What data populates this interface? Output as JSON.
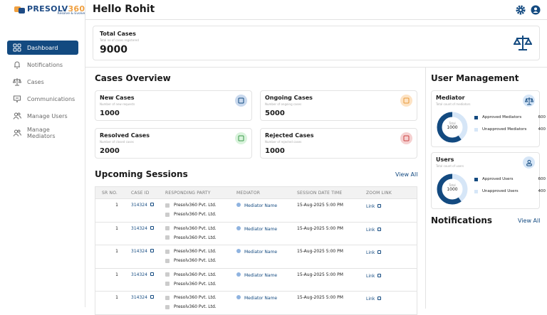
{
  "brand": {
    "name": "PRESOLV",
    "num": "360",
    "tagline": "Resolve & Evolve"
  },
  "sidebar": {
    "items": [
      {
        "label": "Dashboard",
        "icon": "grid-icon",
        "active": true
      },
      {
        "label": "Notifications",
        "icon": "bell-icon"
      },
      {
        "label": "Cases",
        "icon": "scales-icon"
      },
      {
        "label": "Communications",
        "icon": "chat-icon"
      },
      {
        "label": "Manage Users",
        "icon": "users-icon"
      },
      {
        "label": "Manage Mediators",
        "icon": "users-icon"
      }
    ]
  },
  "header": {
    "greeting": "Hello Rohit"
  },
  "total": {
    "title": "Total Cases",
    "sub": "Total no of cases registered",
    "value": "9000"
  },
  "overview": {
    "title": "Cases Overview",
    "cards": [
      {
        "title": "New Cases",
        "sub": "Number of new requests",
        "value": "1000",
        "color": "#c9d9ee"
      },
      {
        "title": "Ongoing Cases",
        "sub": "Number of ongoing cases",
        "value": "5000",
        "color": "#fde3c4"
      },
      {
        "title": "Resolved Cases",
        "sub": "Number of closed cases",
        "value": "2000",
        "color": "#d9f3dc"
      },
      {
        "title": "Rejected Cases",
        "sub": "Number of rejected cases",
        "value": "1000",
        "color": "#f5d0d0"
      }
    ]
  },
  "sessions": {
    "title": "Upcoming Sessions",
    "view_all": "View All",
    "columns": [
      "SR NO.",
      "CASE ID",
      "RESPONDING PARTY",
      "MEDIATOR",
      "SESSION DATE TIME",
      "ZOOM LINK"
    ],
    "rows": [
      {
        "sr": "1",
        "case": "314324",
        "party1": "Presolv360 Pvt. Ltd.",
        "party2": "Presolv360 Pvt. Ltd.",
        "mediator": "Mediator Name",
        "date": "15-Aug-2025 5:00 PM",
        "link": "Link"
      },
      {
        "sr": "1",
        "case": "314324",
        "party1": "Presolv360 Pvt. Ltd.",
        "party2": "Presolv360 Pvt. Ltd.",
        "mediator": "Mediator Name",
        "date": "15-Aug-2025 5:00 PM",
        "link": "Link"
      },
      {
        "sr": "1",
        "case": "314324",
        "party1": "Presolv360 Pvt. Ltd.",
        "party2": "Presolv360 Pvt. Ltd.",
        "mediator": "Mediator Name",
        "date": "15-Aug-2025 5:00 PM",
        "link": "Link"
      },
      {
        "sr": "1",
        "case": "314324",
        "party1": "Presolv360 Pvt. Ltd.",
        "party2": "Presolv360 Pvt. Ltd.",
        "mediator": "Mediator Name",
        "date": "15-Aug-2025 5:00 PM",
        "link": "Link"
      },
      {
        "sr": "1",
        "case": "314324",
        "party1": "Presolv360 Pvt. Ltd.",
        "party2": "Presolv360 Pvt. Ltd.",
        "mediator": "Mediator Name",
        "date": "15-Aug-2025 5:00 PM",
        "link": "Link"
      }
    ]
  },
  "users": {
    "title": "User Management",
    "cards": [
      {
        "title": "Mediator",
        "sub": "Total count of mediators",
        "total_label": "Total",
        "total": "1000",
        "icon": "scales-icon",
        "legend": [
          {
            "label": "Approved Mediators",
            "value": "600",
            "color": "#134a80"
          },
          {
            "label": "Unapproved Mediators",
            "value": "400",
            "color": "#d6e6f7"
          }
        ]
      },
      {
        "title": "Users",
        "sub": "Total count of users",
        "total_label": "Total",
        "total": "1000",
        "icon": "user-icon",
        "legend": [
          {
            "label": "Approved Users",
            "value": "600",
            "color": "#134a80"
          },
          {
            "label": "Unapproved Users",
            "value": "400",
            "color": "#d6e6f7"
          }
        ]
      }
    ]
  },
  "notifications": {
    "title": "Notifications",
    "view_all": "View All"
  }
}
